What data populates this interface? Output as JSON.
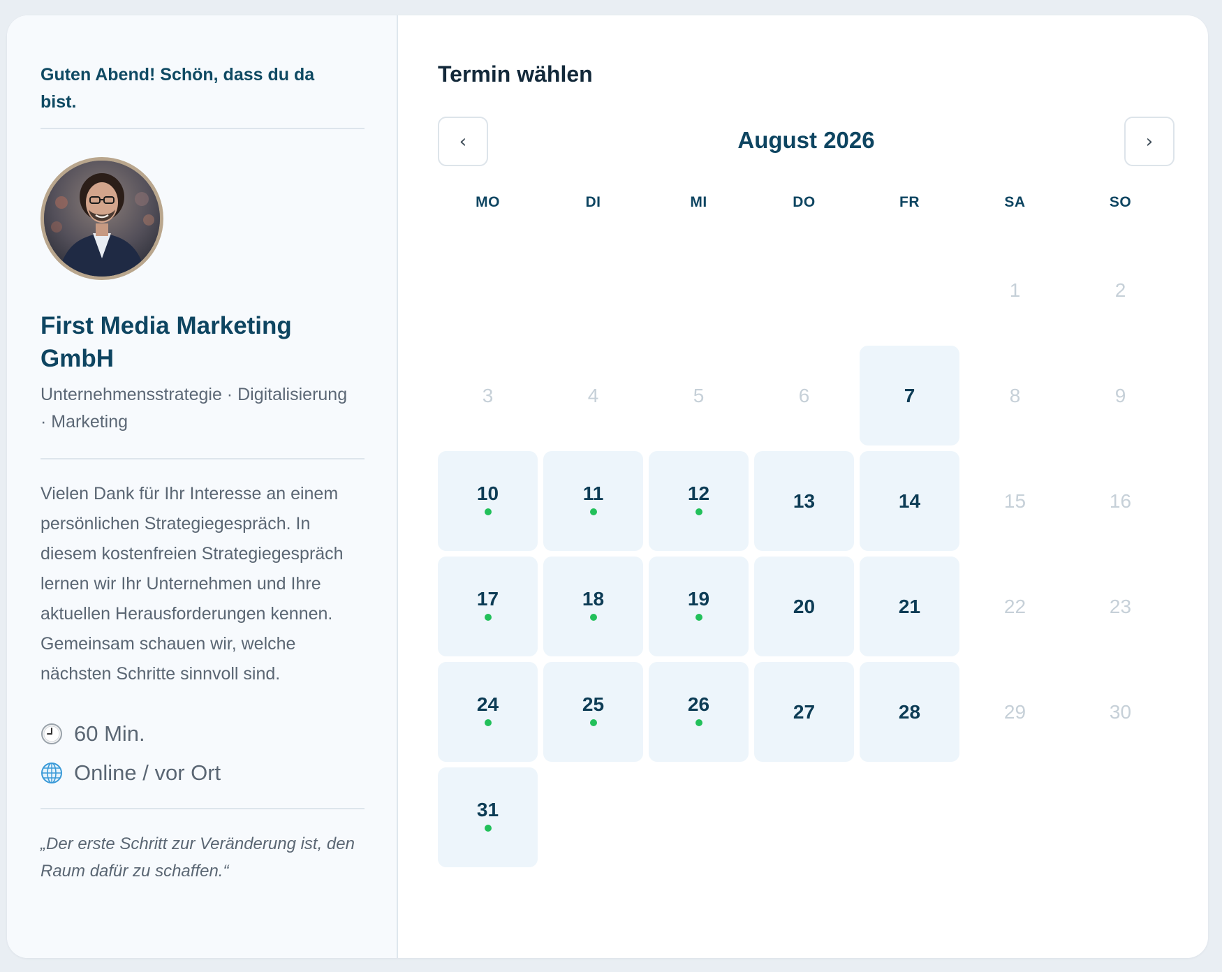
{
  "sidebar": {
    "greeting": "Guten Abend! Schön, dass du da bist.",
    "company": "First Media Marketing GmbH",
    "tags": "Unternehmensstrategie · Digitalisierung · Marketing",
    "description": "Vielen Dank für Ihr Interesse an einem persönlichen Strategiegespräch. In diesem kostenfreien Strategiegespräch lernen wir Ihr Unternehmen und Ihre aktuellen Herausforderungen kennen. Gemeinsam schauen wir, welche nächsten Schritte sinnvoll sind.",
    "duration": "60 Min.",
    "location": "Online / vor Ort",
    "quote": "„Der erste Schritt zur Veränderung ist, den Raum dafür zu schaffen.“"
  },
  "calendar": {
    "title": "Termin wählen",
    "month_label": "August 2026",
    "prev_label": "‹",
    "next_label": "›",
    "weekdays": [
      "MO",
      "DI",
      "MI",
      "DO",
      "FR",
      "SA",
      "SO"
    ],
    "leading_blank_days": 5,
    "days": [
      {
        "n": "1",
        "state": "disabled",
        "dot": false
      },
      {
        "n": "2",
        "state": "disabled",
        "dot": false
      },
      {
        "n": "3",
        "state": "disabled",
        "dot": false
      },
      {
        "n": "4",
        "state": "disabled",
        "dot": false
      },
      {
        "n": "5",
        "state": "disabled",
        "dot": false
      },
      {
        "n": "6",
        "state": "disabled",
        "dot": false
      },
      {
        "n": "7",
        "state": "available",
        "dot": false
      },
      {
        "n": "8",
        "state": "disabled",
        "dot": false
      },
      {
        "n": "9",
        "state": "disabled",
        "dot": false
      },
      {
        "n": "10",
        "state": "available",
        "dot": true
      },
      {
        "n": "11",
        "state": "available",
        "dot": true
      },
      {
        "n": "12",
        "state": "available",
        "dot": true
      },
      {
        "n": "13",
        "state": "available",
        "dot": false
      },
      {
        "n": "14",
        "state": "available",
        "dot": false
      },
      {
        "n": "15",
        "state": "disabled",
        "dot": false
      },
      {
        "n": "16",
        "state": "disabled",
        "dot": false
      },
      {
        "n": "17",
        "state": "available",
        "dot": true
      },
      {
        "n": "18",
        "state": "available",
        "dot": true
      },
      {
        "n": "19",
        "state": "available",
        "dot": true
      },
      {
        "n": "20",
        "state": "available",
        "dot": false
      },
      {
        "n": "21",
        "state": "available",
        "dot": false
      },
      {
        "n": "22",
        "state": "disabled",
        "dot": false
      },
      {
        "n": "23",
        "state": "disabled",
        "dot": false
      },
      {
        "n": "24",
        "state": "available",
        "dot": true
      },
      {
        "n": "25",
        "state": "available",
        "dot": true
      },
      {
        "n": "26",
        "state": "available",
        "dot": true
      },
      {
        "n": "27",
        "state": "available",
        "dot": false
      },
      {
        "n": "28",
        "state": "available",
        "dot": false
      },
      {
        "n": "29",
        "state": "disabled",
        "dot": false
      },
      {
        "n": "30",
        "state": "disabled",
        "dot": false
      },
      {
        "n": "31",
        "state": "available",
        "dot": true
      }
    ]
  },
  "colors": {
    "brand": "#0e4561",
    "available_bg": "#edf5fb",
    "available_dot": "#22c05a",
    "disabled_text": "#c6d0d8",
    "avatar_border": "#b9a68d"
  },
  "icons": {
    "duration": "clock-icon",
    "location": "globe-icon",
    "prev": "chevron-left-icon",
    "next": "chevron-right-icon"
  }
}
